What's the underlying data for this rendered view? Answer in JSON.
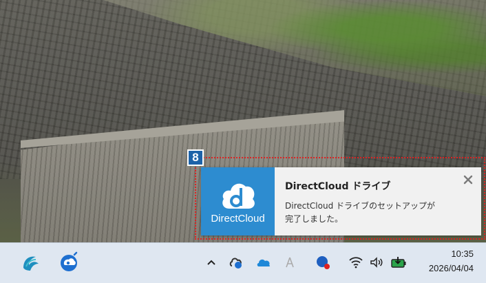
{
  "annotation": {
    "badge_number": "8"
  },
  "notification": {
    "app_logo_text": "DirectCloud",
    "title": "DirectCloud ドライブ",
    "body_line1": "DirectCloud ドライブのセットアップが",
    "body_line2": "完了しました。",
    "close_glyph": "×"
  },
  "taskbar": {
    "pinned_apps": [
      "wave-app-icon",
      "directcloud-app-icon"
    ],
    "tray_icons": [
      "chevron-up-icon",
      "cloud-sync-icon",
      "onedrive-icon",
      "ime-icon",
      "security-icon",
      "wifi-icon",
      "volume-icon",
      "battery-icon"
    ],
    "time": "10:35",
    "date": "2026/04/04"
  },
  "colors": {
    "brand_blue": "#2d8cd0",
    "badge_blue": "#1d63a8",
    "highlight_red": "#dd2222",
    "taskbar_bg": "#dfe7f1"
  }
}
